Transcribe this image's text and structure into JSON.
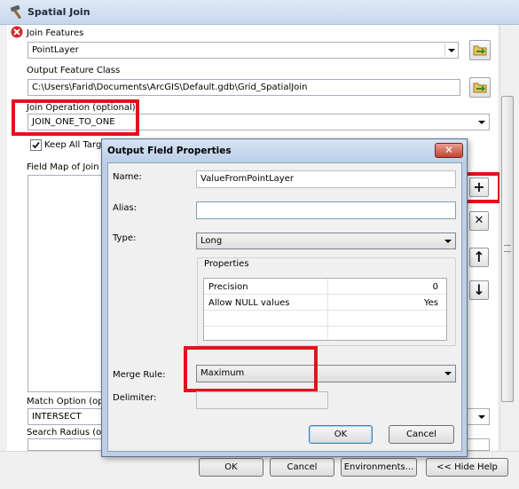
{
  "window": {
    "title": "Spatial Join"
  },
  "form": {
    "join_features_label": "Join Features",
    "join_features_value": "PointLayer",
    "output_class_label": "Output Feature Class",
    "output_class_value": "C:\\Users\\Farid\\Documents\\ArcGIS\\Default.gdb\\Grid_SpatialJoin",
    "join_operation_label": "Join Operation (optional)",
    "join_operation_value": "JOIN_ONE_TO_ONE",
    "keep_all_label": "Keep All Targ",
    "field_map_label": "Field Map of Join",
    "match_option_label": "Match Option (op",
    "match_option_value": "INTERSECT",
    "search_radius_label": "Search Radius (op"
  },
  "side_buttons": {
    "add": "+",
    "remove": "✕",
    "up": "↑",
    "down": "↓"
  },
  "buttons": {
    "ok": "OK",
    "cancel": "Cancel",
    "environments": "Environments...",
    "hide_help": "<< Hide Help"
  },
  "dialog": {
    "title": "Output Field Properties",
    "close": "✕",
    "name_label": "Name:",
    "name_value": "ValueFromPointLayer",
    "alias_label": "Alias:",
    "alias_value": "",
    "type_label": "Type:",
    "type_value": "Long",
    "properties_label": "Properties",
    "properties": [
      {
        "key": "Precision",
        "value": "0"
      },
      {
        "key": "Allow NULL values",
        "value": "Yes"
      }
    ],
    "merge_rule_label": "Merge Rule:",
    "merge_rule_value": "Maximum",
    "delimiter_label": "Delimiter:",
    "ok": "OK",
    "cancel": "Cancel"
  },
  "colors": {
    "highlight": "#e0141e",
    "error": "#d0282a"
  }
}
